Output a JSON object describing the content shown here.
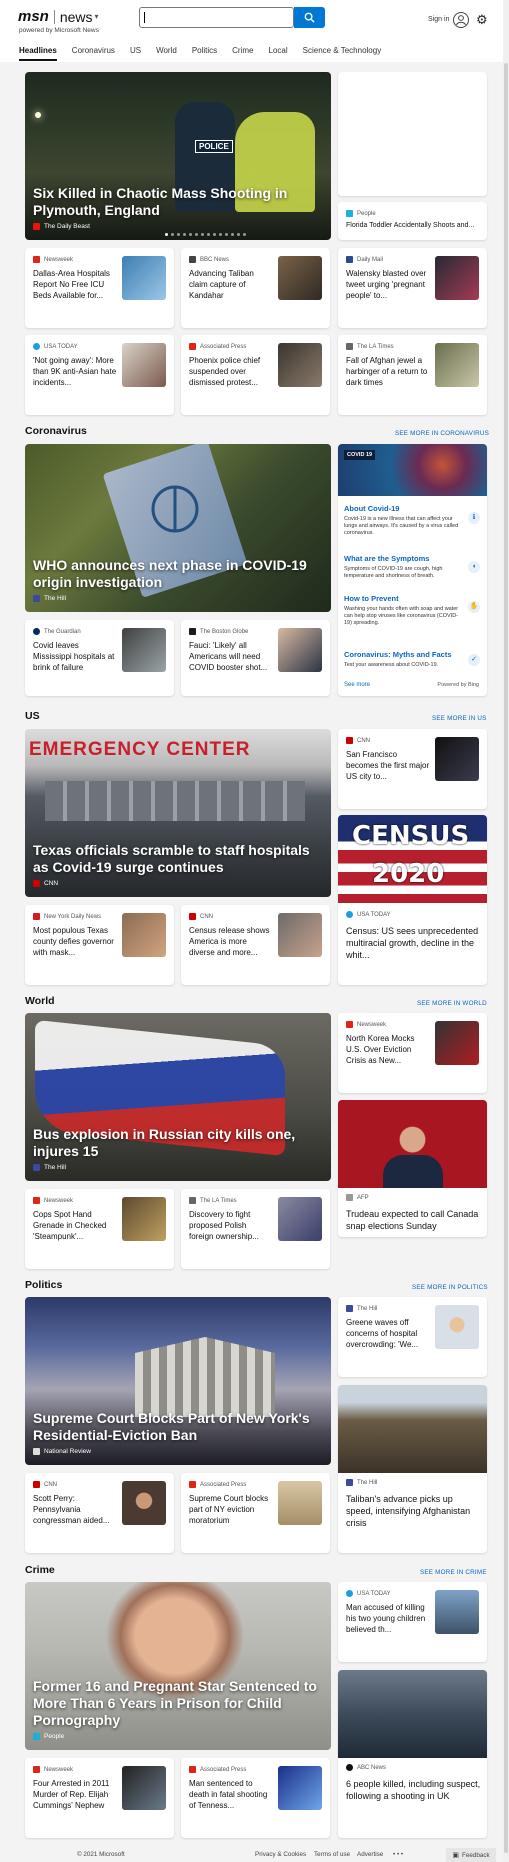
{
  "header": {
    "brand": "msn",
    "product": "news",
    "powered_by": "powered by Microsoft News",
    "search_value": "",
    "sign_in": "Sign in"
  },
  "nav": [
    "Headlines",
    "Coronavirus",
    "US",
    "World",
    "Politics",
    "Crime",
    "Local",
    "Science & Technology"
  ],
  "top": {
    "hero": {
      "title": "Six Killed in Chaotic Mass Shooting in Plymouth, England",
      "source": "The Daily Beast",
      "badge_text": "POLICE"
    },
    "side": {
      "source": "People",
      "title": "Florida Toddler Accidentally Shoots and..."
    },
    "row1": [
      {
        "source": "Newsweek",
        "title": "Dallas-Area Hospitals Report No Free ICU Beds Available for..."
      },
      {
        "source": "BBC News",
        "title": "Advancing Taliban claim capture of Kandahar"
      },
      {
        "source": "Daily Mail",
        "title": "Walensky blasted over tweet urging 'pregnant people' to..."
      }
    ],
    "row2": [
      {
        "source": "USA TODAY",
        "title": "'Not going away': More than 9K anti-Asian hate incidents..."
      },
      {
        "source": "Associated Press",
        "title": "Phoenix police chief suspended over dismissed protest..."
      },
      {
        "source": "The LA Times",
        "title": "Fall of Afghan jewel a harbinger of a return to dark times"
      }
    ]
  },
  "coronavirus": {
    "heading": "Coronavirus",
    "more": "SEE MORE IN CORONAVIRUS",
    "hero": {
      "title": "WHO announces next phase in COVID-19 origin investigation",
      "source": "The Hill"
    },
    "panel": {
      "tag": "COVID 19",
      "items": [
        {
          "title": "About Covid-19",
          "desc": "Covid-19 is a new illness that can affect your lungs and airways. It's caused by a virus called coronavirus."
        },
        {
          "title": "What are the Symptoms",
          "desc": "Symptoms of COVID-19 are cough, high temperature and shortness of breath."
        },
        {
          "title": "How to Prevent",
          "desc": "Washing your hands often with soap and water can help stop viruses like coronavirus (COVID-19) spreading."
        },
        {
          "title": "Coronavirus: Myths and Facts",
          "desc": "Test your awareness about COVID-19."
        }
      ],
      "see_more": "See more",
      "powered": "Powered by Bing"
    },
    "row": [
      {
        "source": "The Guardian",
        "title": "Covid leaves Mississippi hospitals at brink of failure"
      },
      {
        "source": "The Boston Globe",
        "title": "Fauci: 'Likely' all Americans will need COVID booster shot..."
      }
    ]
  },
  "us": {
    "heading": "US",
    "more": "SEE MORE IN US",
    "hero": {
      "title": "Texas officials scramble to staff hospitals as Covid-19 surge continues",
      "source": "CNN",
      "sign": "EMERGENCY CENTER"
    },
    "side": {
      "source": "CNN",
      "title": "San Francisco becomes the first major US city to..."
    },
    "census": {
      "img_text_1": "CENSUS",
      "img_text_2": "2020",
      "source": "USA TODAY",
      "title": "Census: US sees unprecedented multiracial growth, decline in the whit..."
    },
    "row": [
      {
        "source": "New York Daily News",
        "title": "Most populous Texas county defies governor with mask..."
      },
      {
        "source": "CNN",
        "title": "Census release shows America is more diverse and more..."
      }
    ]
  },
  "world": {
    "heading": "World",
    "more": "SEE MORE IN WORLD",
    "hero": {
      "title": "Bus explosion in Russian city kills one, injures 15",
      "source": "The Hill"
    },
    "side": {
      "source": "Newsweek",
      "title": "North Korea Mocks U.S. Over Eviction Crisis as New..."
    },
    "trudeau": {
      "source": "AFP",
      "title": "Trudeau expected to call Canada snap elections Sunday"
    },
    "row": [
      {
        "source": "Newsweek",
        "title": "Cops Spot Hand Grenade in Checked 'Steampunk'..."
      },
      {
        "source": "The LA Times",
        "title": "Discovery to fight proposed Polish foreign ownership..."
      }
    ]
  },
  "politics": {
    "heading": "Politics",
    "more": "SEE MORE IN POLITICS",
    "hero": {
      "title": "Supreme Court Blocks Part of New York's Residential-Eviction Ban",
      "source": "National Review"
    },
    "side": {
      "source": "The Hill",
      "title": "Greene waves off concerns of hospital overcrowding: 'We..."
    },
    "taliban": {
      "source": "The Hill",
      "title": "Taliban's advance picks up speed, intensifying Afghanistan crisis"
    },
    "row": [
      {
        "source": "CNN",
        "title": "Scott Perry: Pennsylvania congressman aided..."
      },
      {
        "source": "Associated Press",
        "title": "Supreme Court blocks part of NY eviction moratorium"
      }
    ]
  },
  "crime": {
    "heading": "Crime",
    "more": "SEE MORE IN CRIME",
    "hero": {
      "title": "Former 16 and Pregnant Star Sentenced to More Than 6 Years in Prison for Child Pornography",
      "source": "People"
    },
    "side": {
      "source": "USA TODAY",
      "title": "Man accused of killing his two young children believed th..."
    },
    "abc": {
      "source": "ABC News",
      "title": "6 people killed, including suspect, following a shooting in UK"
    },
    "row": [
      {
        "source": "Newsweek",
        "title": "Four Arrested in 2011 Murder of Rep. Elijah Cummings' Nephew"
      },
      {
        "source": "Associated Press",
        "title": "Man sentenced to death in fatal shooting of Tenness..."
      }
    ]
  },
  "footer": {
    "copyright": "© 2021 Microsoft",
    "privacy": "Privacy & Cookies",
    "terms": "Terms of use",
    "advertise": "Advertise",
    "more": "• • •",
    "feedback": "Feedback"
  },
  "colors": {
    "accent": "#0078d4",
    "link": "#0a66c2"
  }
}
